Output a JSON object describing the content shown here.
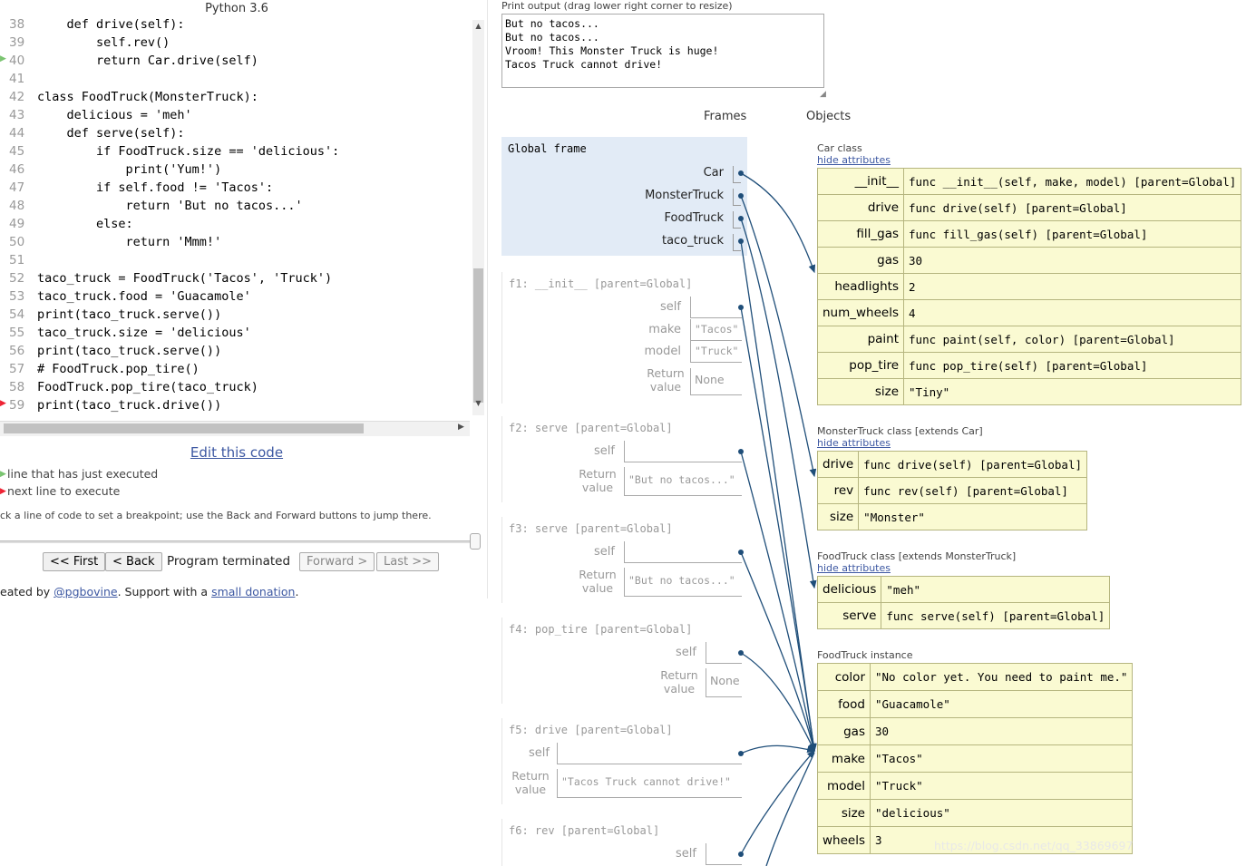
{
  "language": "Python 3.6",
  "code_lines": [
    {
      "n": "38",
      "t": "    def drive(self):"
    },
    {
      "n": "39",
      "t": "        self.rev()"
    },
    {
      "n": "40",
      "t": "        return Car.drive(self)"
    },
    {
      "n": "41",
      "t": ""
    },
    {
      "n": "42",
      "t": "class FoodTruck(MonsterTruck):"
    },
    {
      "n": "43",
      "t": "    delicious = 'meh'"
    },
    {
      "n": "44",
      "t": "    def serve(self):"
    },
    {
      "n": "45",
      "t": "        if FoodTruck.size == 'delicious':"
    },
    {
      "n": "46",
      "t": "            print('Yum!')"
    },
    {
      "n": "47",
      "t": "        if self.food != 'Tacos':"
    },
    {
      "n": "48",
      "t": "            return 'But no tacos...'"
    },
    {
      "n": "49",
      "t": "        else:"
    },
    {
      "n": "50",
      "t": "            return 'Mmm!'"
    },
    {
      "n": "51",
      "t": ""
    },
    {
      "n": "52",
      "t": "taco_truck = FoodTruck('Tacos', 'Truck')"
    },
    {
      "n": "53",
      "t": "taco_truck.food = 'Guacamole'"
    },
    {
      "n": "54",
      "t": "print(taco_truck.serve())"
    },
    {
      "n": "55",
      "t": "taco_truck.size = 'delicious'"
    },
    {
      "n": "56",
      "t": "print(taco_truck.serve())"
    },
    {
      "n": "57",
      "t": "# FoodTruck.pop_tire()"
    },
    {
      "n": "58",
      "t": "FoodTruck.pop_tire(taco_truck)"
    },
    {
      "n": "59",
      "t": "print(taco_truck.drive())"
    }
  ],
  "edit_link": "Edit this code",
  "legend": {
    "executed": "line that has just executed",
    "next": "next line to execute"
  },
  "hint": "ck a line of code to set a breakpoint; use the Back and Forward buttons to jump there.",
  "nav": {
    "first": "<< First",
    "back": "< Back",
    "status": "Program terminated",
    "forward": "Forward >",
    "last": "Last >>"
  },
  "credit": {
    "prefix": "eated by ",
    "author": "@pgbovine",
    "mid": ". Support with a ",
    "donation": "small donation",
    "suffix": "."
  },
  "print_label": "Print output (drag lower right corner to resize)",
  "print_output": "But no tacos...\nBut no tacos...\nVroom! This Monster Truck is huge!\nTacos Truck cannot drive!",
  "headers": {
    "frames": "Frames",
    "objects": "Objects"
  },
  "global_frame": {
    "title": "Global frame",
    "vars": [
      "Car",
      "MonsterTruck",
      "FoodTruck",
      "taco_truck"
    ]
  },
  "frames": [
    {
      "title": "f1: __init__ [parent=Global]",
      "self": "self",
      "vars": [
        {
          "k": "make",
          "v": "\"Tacos\""
        },
        {
          "k": "model",
          "v": "\"Truck\""
        }
      ],
      "return_label_1": "Return",
      "return_label_2": "value",
      "return_value": "None"
    },
    {
      "title": "f2: serve [parent=Global]",
      "self": "self",
      "return_label_1": "Return",
      "return_label_2": "value",
      "return_value": "\"But no tacos...\""
    },
    {
      "title": "f3: serve [parent=Global]",
      "self": "self",
      "return_label_1": "Return",
      "return_label_2": "value",
      "return_value": "\"But no tacos...\""
    },
    {
      "title": "f4: pop_tire [parent=Global]",
      "self": "self",
      "return_label_1": "Return",
      "return_label_2": "value",
      "return_value": "None"
    },
    {
      "title": "f5: drive [parent=Global]",
      "self": "self",
      "return_label_1": "Return",
      "return_label_2": "value",
      "return_value": "\"Tacos Truck cannot drive!\""
    },
    {
      "title": "f6: rev [parent=Global]",
      "self": "self"
    }
  ],
  "hide_attributes": "hide attributes",
  "car_class": {
    "label": "Car class",
    "rows": [
      {
        "k": "__init__",
        "v": "func __init__(self, make, model) [parent=Global]"
      },
      {
        "k": "drive",
        "v": "func drive(self) [parent=Global]"
      },
      {
        "k": "fill_gas",
        "v": "func fill_gas(self) [parent=Global]"
      },
      {
        "k": "gas",
        "v": "30"
      },
      {
        "k": "headlights",
        "v": "2"
      },
      {
        "k": "num_wheels",
        "v": "4"
      },
      {
        "k": "paint",
        "v": "func paint(self, color) [parent=Global]"
      },
      {
        "k": "pop_tire",
        "v": "func pop_tire(self) [parent=Global]"
      },
      {
        "k": "size",
        "v": "\"Tiny\""
      }
    ]
  },
  "monster_class": {
    "label": "MonsterTruck class [extends Car]",
    "rows": [
      {
        "k": "drive",
        "v": "func drive(self) [parent=Global]"
      },
      {
        "k": "rev",
        "v": "func rev(self) [parent=Global]"
      },
      {
        "k": "size",
        "v": "\"Monster\""
      }
    ]
  },
  "food_class": {
    "label": "FoodTruck class [extends MonsterTruck]",
    "rows": [
      {
        "k": "delicious",
        "v": "\"meh\""
      },
      {
        "k": "serve",
        "v": "func serve(self) [parent=Global]"
      }
    ]
  },
  "instance": {
    "label": "FoodTruck instance",
    "rows": [
      {
        "k": "color",
        "v": "\"No color yet. You need to paint me.\""
      },
      {
        "k": "food",
        "v": "\"Guacamole\""
      },
      {
        "k": "gas",
        "v": "30"
      },
      {
        "k": "make",
        "v": "\"Tacos\""
      },
      {
        "k": "model",
        "v": "\"Truck\""
      },
      {
        "k": "size",
        "v": "\"delicious\""
      },
      {
        "k": "wheels",
        "v": "3"
      }
    ]
  },
  "watermark": "https://blog.csdn.net/qq_33869697",
  "colors": {
    "arrow": "#1f4e79",
    "frame_bg": "#e2ebf6",
    "object_bg": "#fafad2",
    "link": "#3d58a2"
  }
}
